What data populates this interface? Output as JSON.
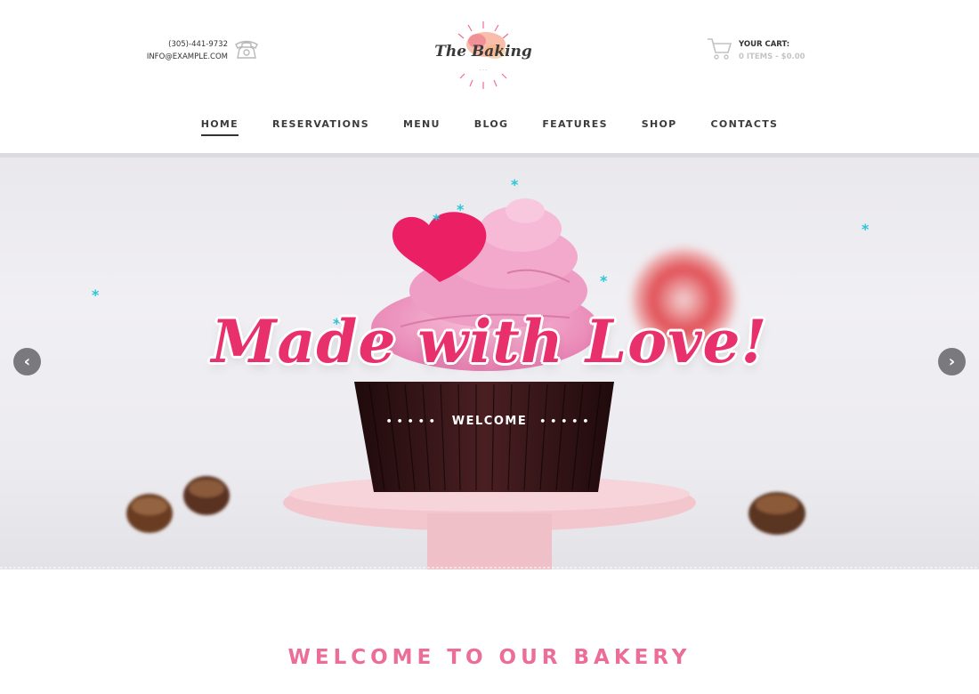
{
  "header": {
    "phone": "(305)-441-9732",
    "email": "INFO@EXAMPLE.COM",
    "logo_text": "The Baking",
    "cart_label": "YOUR CART:",
    "cart_summary": "0 ITEMS - $0.00",
    "icons": {
      "phone": "phone-icon",
      "cart": "cart-icon"
    }
  },
  "nav": {
    "items": [
      {
        "label": "HOME",
        "active": true
      },
      {
        "label": "RESERVATIONS"
      },
      {
        "label": "MENU"
      },
      {
        "label": "BLOG"
      },
      {
        "label": "FEATURES"
      },
      {
        "label": "SHOP"
      },
      {
        "label": "CONTACTS"
      }
    ]
  },
  "hero": {
    "title": "Made with Love!",
    "subtitle": "WELCOME",
    "dots": "•••••",
    "prev_icon": "chevron-left-icon",
    "next_icon": "chevron-right-icon"
  },
  "welcome": {
    "heading": "WELCOME TO OUR BAKERY"
  },
  "colors": {
    "accent": "#e8306d",
    "heading_pink": "#ec6c9a",
    "nav_text": "#3c3c3c",
    "cart_muted": "#c4c4c4"
  }
}
